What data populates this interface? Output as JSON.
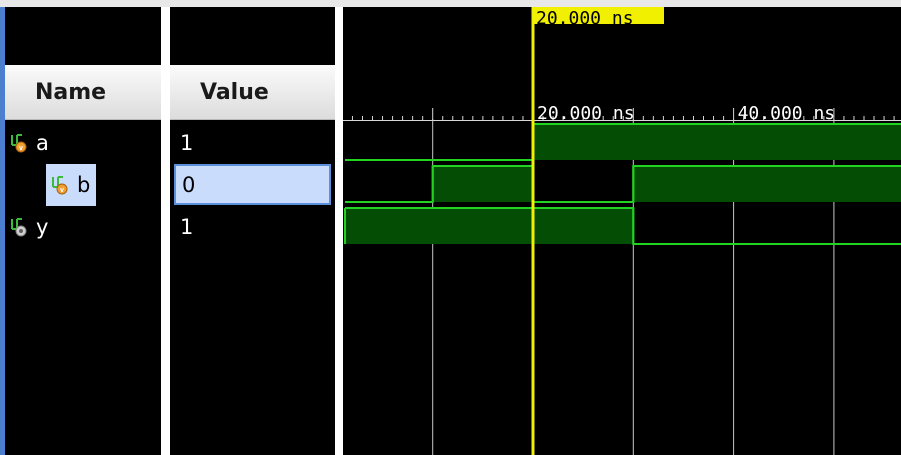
{
  "columns": {
    "name": "Name",
    "value": "Value"
  },
  "signals": [
    {
      "name": "a",
      "value": "1",
      "icon": "input-signal-icon",
      "selected": false,
      "high": [
        [
          0,
          0
        ],
        [
          20,
          40
        ]
      ]
    },
    {
      "name": "b",
      "value": "0",
      "icon": "input-signal-icon",
      "selected": true
    },
    {
      "name": "y",
      "value": "1",
      "icon": "output-signal-icon",
      "selected": false
    }
  ],
  "waveform": {
    "cursor_label": "20.000 ns",
    "time_labels": [
      "20.000 ns",
      "40.000 ns"
    ],
    "time_unit": "ns",
    "transitions": {
      "a": [
        {
          "t": 0,
          "v": 0
        },
        {
          "t": 20,
          "v": 1
        }
      ],
      "b": [
        {
          "t": 0,
          "v": 0
        },
        {
          "t": 10,
          "v": 1
        },
        {
          "t": 20,
          "v": 0
        },
        {
          "t": 30,
          "v": 1
        }
      ],
      "y": [
        {
          "t": 0,
          "v": 1
        },
        {
          "t": 30,
          "v": 0
        }
      ]
    },
    "cursor_time": 20,
    "gridline_times": [
      10,
      20,
      30,
      40,
      50
    ],
    "colors": {
      "wave": "#22d322",
      "wave_fill": "#044d04",
      "cursor": "#f0f000",
      "grid": "#c8c8c8",
      "background": "#000000"
    }
  }
}
